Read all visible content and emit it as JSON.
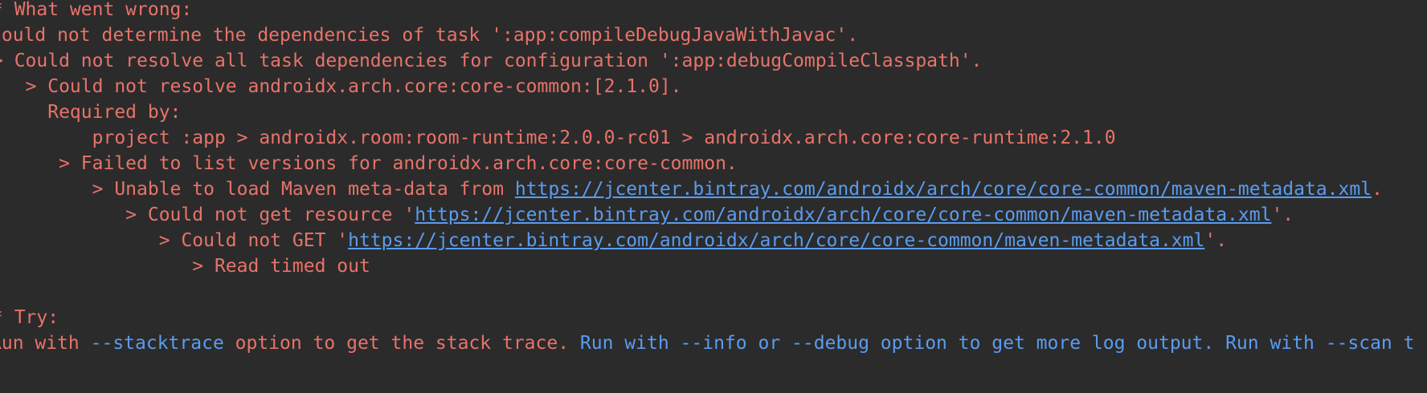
{
  "colors": {
    "background": "#2b2b2b",
    "error_text": "#e8736a",
    "link": "#5a9cf0"
  },
  "lines": {
    "what_went_wrong": "* What went wrong:",
    "could_not_determine": "Could not determine the dependencies of task ':app:compileDebugJavaWithJavac'.",
    "could_not_resolve_all": "> Could not resolve all task dependencies for configuration ':app:debugCompileClasspath'.",
    "could_not_resolve_core": "   > Could not resolve androidx.arch.core:core-common:[2.1.0].",
    "required_by": "     Required by:",
    "project_app": "         project :app > androidx.room:room-runtime:2.0.0-rc01 > androidx.arch.core:core-runtime:2.1.0",
    "failed_to_list": "      > Failed to list versions for androidx.arch.core:core-common.",
    "unable_prefix": "         > Unable to load Maven meta-data from ",
    "unable_suffix": ".",
    "could_not_get_prefix": "            > Could not get resource '",
    "could_not_get_suffix": "'.",
    "could_not_GET_prefix": "               > Could not GET '",
    "could_not_GET_suffix": "'.",
    "read_timed_out": "                  > Read timed out",
    "try": "* Try:",
    "run_with_1": "Run with ",
    "stacktrace": "--stacktrace",
    "run_with_2": " option to get the stack trace. ",
    "run_with_3": "Run with ",
    "info": "--info",
    "or_text": " or ",
    "debug": "--debug",
    "run_with_4": " option to get more log output. ",
    "run_with_5": "Run with ",
    "scan": "--scan t"
  },
  "metadata_url": "https://jcenter.bintray.com/androidx/arch/core/core-common/maven-metadata.xml"
}
